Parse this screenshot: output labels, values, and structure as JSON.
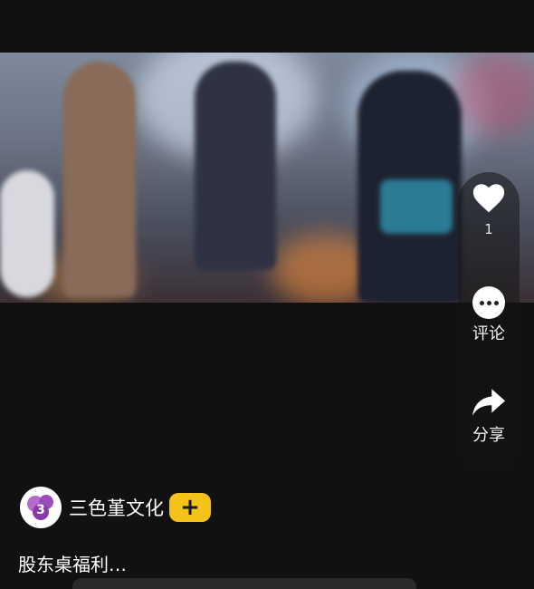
{
  "actions": {
    "like_count": "1",
    "comment_label": "评论",
    "share_label": "分享"
  },
  "author": {
    "name": "三色堇文化",
    "avatar_text": "3",
    "follow_label": "+"
  },
  "caption": "股东桌福利…",
  "colors": {
    "background": "#111111",
    "follow_button": "#f4c31a",
    "avatar_accent": "#8a3aa8"
  },
  "icons": {
    "like": "heart-icon",
    "comment": "comment-icon",
    "share": "share-icon",
    "follow": "plus-icon"
  }
}
